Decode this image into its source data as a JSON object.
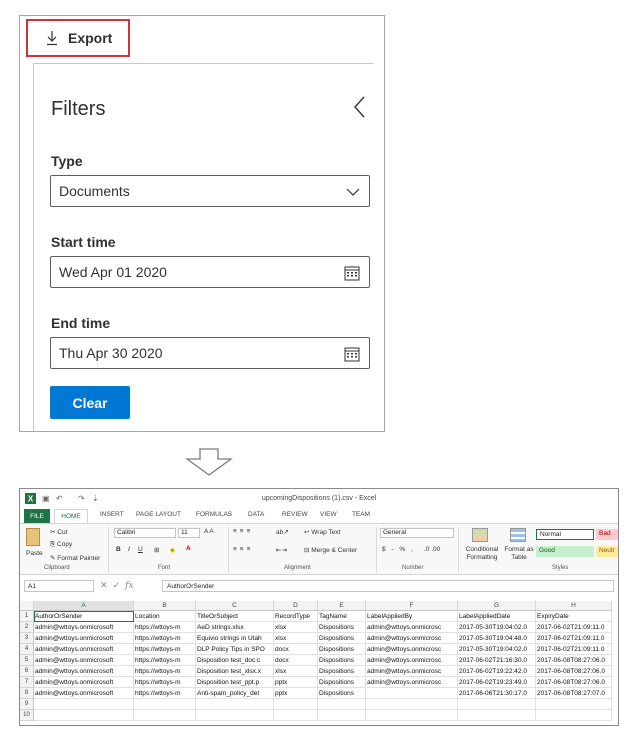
{
  "toolbar": {
    "export_label": "Export"
  },
  "filters": {
    "title": "Filters",
    "type_label": "Type",
    "type_value": "Documents",
    "start_label": "Start time",
    "start_value": "Wed Apr 01 2020",
    "end_label": "End time",
    "end_value": "Thu Apr 30 2020",
    "clear_label": "Clear"
  },
  "excel": {
    "window_title": "upcomingDispositions (1).csv - Excel",
    "tabs": [
      "FILE",
      "HOME",
      "INSERT",
      "PAGE LAYOUT",
      "FORMULAS",
      "DATA",
      "REVIEW",
      "VIEW",
      "TEAM"
    ],
    "ribbon": {
      "cut": "Cut",
      "copy": "Copy",
      "paste": "Paste",
      "format_painter": "Format Painter",
      "clipboard": "Clipboard",
      "font_name": "Calibri",
      "font_size": "11",
      "font": "Font",
      "wrap_text": "Wrap Text",
      "merge_center": "Merge & Center",
      "alignment": "Alignment",
      "number_format": "General",
      "number": "Number",
      "conditional_formatting": "Conditional Formatting",
      "format_as_table": "Format as Table",
      "styles": "Styles",
      "style_normal": "Normal",
      "style_bad": "Bad",
      "style_good": "Good",
      "style_neutral": "Neutr"
    },
    "name_box": "A1",
    "formula": "AuthorOrSender",
    "columns": [
      "A",
      "B",
      "C",
      "D",
      "E",
      "F",
      "G",
      "H"
    ],
    "rows": [
      [
        "AuthorOrSender",
        "Location",
        "TitleOrSubject",
        "RecordType",
        "TagName",
        "LabelAppliedBy",
        "LabelAppliedDate",
        "ExpiryDate"
      ],
      [
        "admin@wttoys.onmicrosoft",
        "https://wttoys-m",
        "AeD strings.xlsx",
        "xlsx",
        "Dispositions",
        "admin@wttoys.onmicrosc",
        "2017-05-30T19:04:02.0",
        "2017-06-02T21:09:11.0"
      ],
      [
        "admin@wttoys.onmicrosoft",
        "https://wttoys-m",
        "Equivio strings in Utah",
        "xlsx",
        "Dispositions",
        "admin@wttoys.onmicrosc",
        "2017-05-30T19:04:48.0",
        "2017-06-02T21:09:11.0"
      ],
      [
        "admin@wttoys.onmicrosoft",
        "https://wttoys-m",
        "DLP Policy Tips in SPO",
        "docx",
        "Dispositions",
        "admin@wttoys.onmicrosc",
        "2017-05-30T19:04:02.0",
        "2017-06-02T21:09:11.0"
      ],
      [
        "admin@wttoys.onmicrosoft",
        "https://wttoys-m",
        "Disposition test_doc.c",
        "docx",
        "Dispositions",
        "admin@wttoys.onmicrosc",
        "2017-06-02T21:16:30.0",
        "2017-06-08T08:27:06.0"
      ],
      [
        "admin@wttoys.onmicrosoft",
        "https://wttoys-m",
        "Disposition test_xlsx.x",
        "xlsx",
        "Dispositions",
        "admin@wttoys.onmicrosc",
        "2017-06-02T19:22:42.0",
        "2017-06-08T08:27:06.0"
      ],
      [
        "admin@wttoys.onmicrosoft",
        "https://wttoys-m",
        "Disposition test_ppt.p",
        "pptx",
        "Dispositions",
        "admin@wttoys.onmicrosc",
        "2017-06-02T19:23:49.0",
        "2017-06-08T08:27:06.0"
      ],
      [
        "admin@wttoys.onmicrosoft",
        "https://wttoys-m",
        "Anti-spam_policy_det",
        "pptx",
        "Dispositions",
        "",
        "2017-06-06T21:30:17.0",
        "2017-06-08T08:27:07.0"
      ],
      [
        "",
        "",
        "",
        "",
        "",
        "",
        "",
        ""
      ],
      [
        "",
        "",
        "",
        "",
        "",
        "",
        "",
        ""
      ]
    ]
  },
  "colors": {
    "accent": "#0078d4",
    "highlight": "#d13438",
    "excel_green": "#217346"
  },
  "icons": [
    "download-icon",
    "chevron-left-icon",
    "chevron-down-icon",
    "calendar-icon",
    "excel-logo-icon",
    "down-arrow-icon"
  ]
}
